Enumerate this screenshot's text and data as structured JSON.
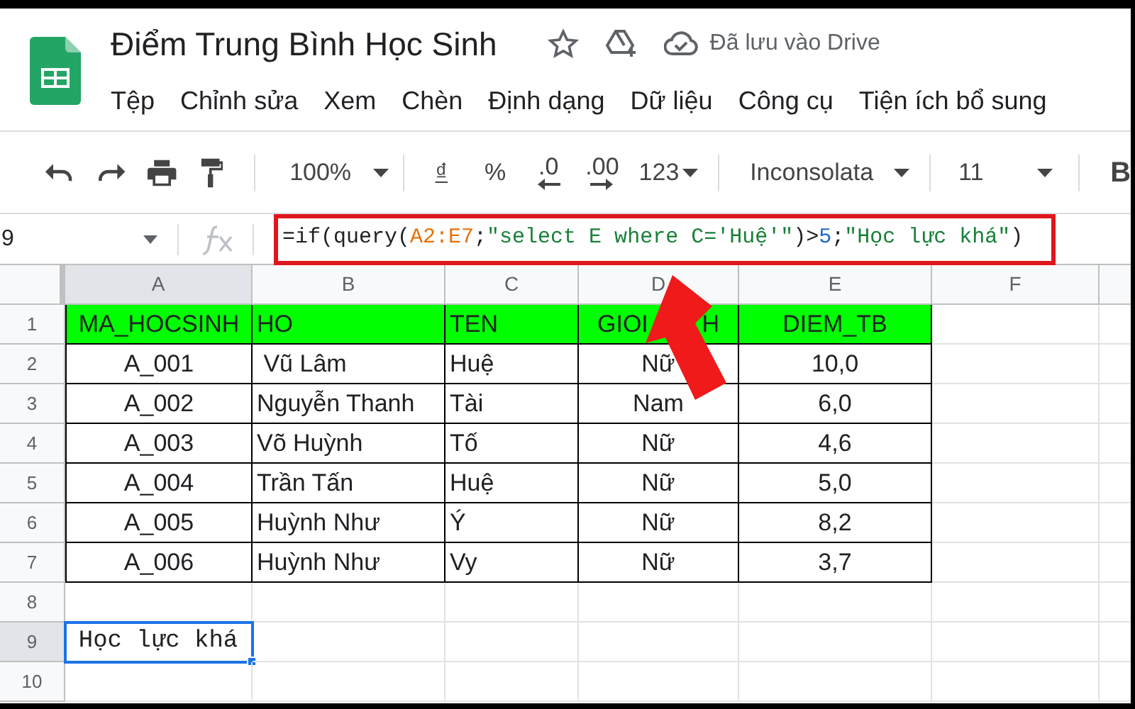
{
  "document": {
    "title": "Điểm Trung Bình Học Sinh",
    "save_status": "Đã lưu vào Drive"
  },
  "menu": [
    "Tệp",
    "Chỉnh sửa",
    "Xem",
    "Chèn",
    "Định dạng",
    "Dữ liệu",
    "Công cụ",
    "Tiện ích bổ sung"
  ],
  "toolbar": {
    "zoom": "100%",
    "currency": "₫",
    "percent": "%",
    "decrease_decimals": ".0",
    "increase_decimals": ".00",
    "more_formats": "123",
    "font": "Inconsolata",
    "font_size": "11",
    "bold": "B"
  },
  "formula_bar": {
    "cell_ref": "9",
    "formula": [
      {
        "kind": "plain",
        "text": "=if(query("
      },
      {
        "kind": "range",
        "text": "A2:E7"
      },
      {
        "kind": "plain",
        "text": ";"
      },
      {
        "kind": "string",
        "text": "\"select E where C='Huệ'\""
      },
      {
        "kind": "plain",
        "text": ")>"
      },
      {
        "kind": "number",
        "text": "5"
      },
      {
        "kind": "plain",
        "text": ";"
      },
      {
        "kind": "string",
        "text": "\"Học lực khá\""
      },
      {
        "kind": "plain",
        "text": ")"
      }
    ]
  },
  "columns": [
    "A",
    "B",
    "C",
    "D",
    "E",
    "F"
  ],
  "rows": [
    {
      "number": "1",
      "kind": "header",
      "cells": [
        "MA_HOCSINH",
        "HO",
        "TEN",
        "GIOI        H",
        "DIEM_TB"
      ]
    },
    {
      "number": "2",
      "kind": "data",
      "cells": [
        "A_001",
        " Vũ Lâm",
        "Huệ",
        "Nữ",
        "10,0"
      ]
    },
    {
      "number": "3",
      "kind": "data",
      "cells": [
        "A_002",
        "Nguyễn Thanh",
        "Tài",
        "Nam",
        "6,0"
      ]
    },
    {
      "number": "4",
      "kind": "data",
      "cells": [
        "A_003",
        "Võ Huỳnh",
        "Tố",
        "Nữ",
        "4,6"
      ]
    },
    {
      "number": "5",
      "kind": "data",
      "cells": [
        "A_004",
        "Trần Tấn",
        "Huệ",
        "Nữ",
        "5,0"
      ]
    },
    {
      "number": "6",
      "kind": "data",
      "cells": [
        "A_005",
        "Huỳnh Như",
        "Ý",
        "Nữ",
        "8,2"
      ]
    },
    {
      "number": "7",
      "kind": "data",
      "cells": [
        "A_006",
        "Huỳnh Như",
        "Vy",
        "Nữ",
        "3,7"
      ]
    },
    {
      "number": "8",
      "kind": "empty"
    },
    {
      "number": "9",
      "kind": "result",
      "cells": [
        {
          "text": "Học lực khá",
          "selected": true
        }
      ]
    },
    {
      "number": "10",
      "kind": "empty"
    }
  ]
}
